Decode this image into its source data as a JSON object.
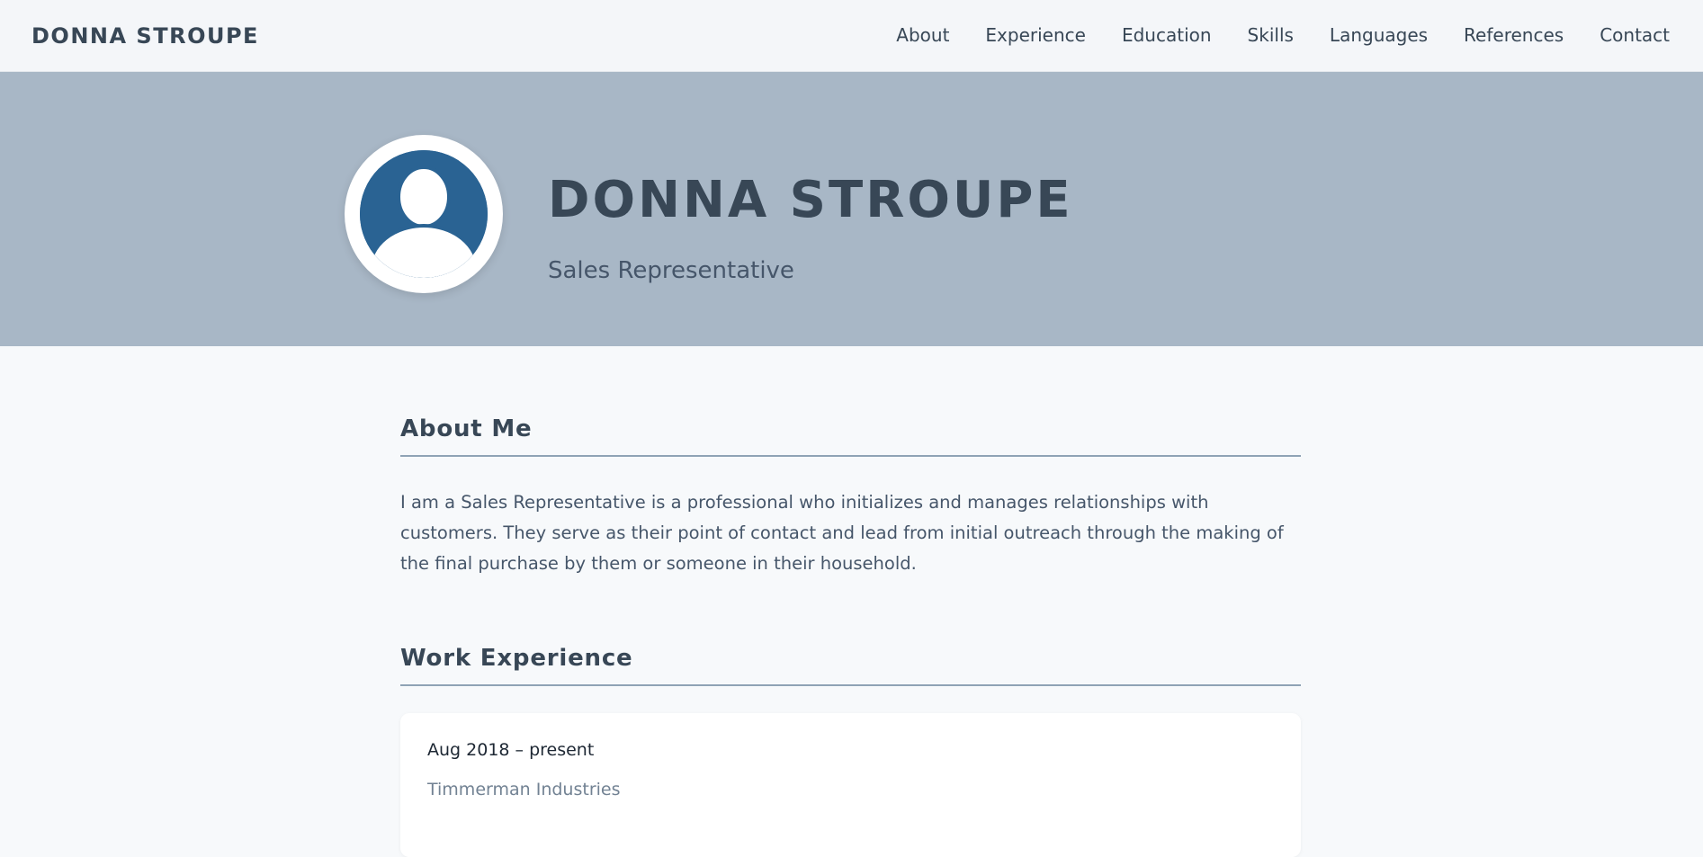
{
  "nav": {
    "brand": "DONNA STROUPE",
    "links": [
      "About",
      "Experience",
      "Education",
      "Skills",
      "Languages",
      "References",
      "Contact"
    ]
  },
  "hero": {
    "name": "DONNA STROUPE",
    "title": "Sales Representative",
    "avatar_icon": "user-silhouette-icon"
  },
  "about": {
    "heading": "About Me",
    "text": "I am a Sales Representative is a professional who initializes and manages relationships with customers. They serve as their point of contact and lead from initial outreach through the making of the final purchase by them or someone in their household."
  },
  "experience": {
    "heading": "Work Experience",
    "jobs": [
      {
        "date": "Aug 2018 – present",
        "company": "Timmerman Industries"
      }
    ]
  },
  "colors": {
    "hero_background": "#a8b7c6",
    "page_background": "#f7f9fb",
    "text_dark": "#384756",
    "avatar_blue": "#2a6393",
    "divider": "#8fa3b5"
  }
}
